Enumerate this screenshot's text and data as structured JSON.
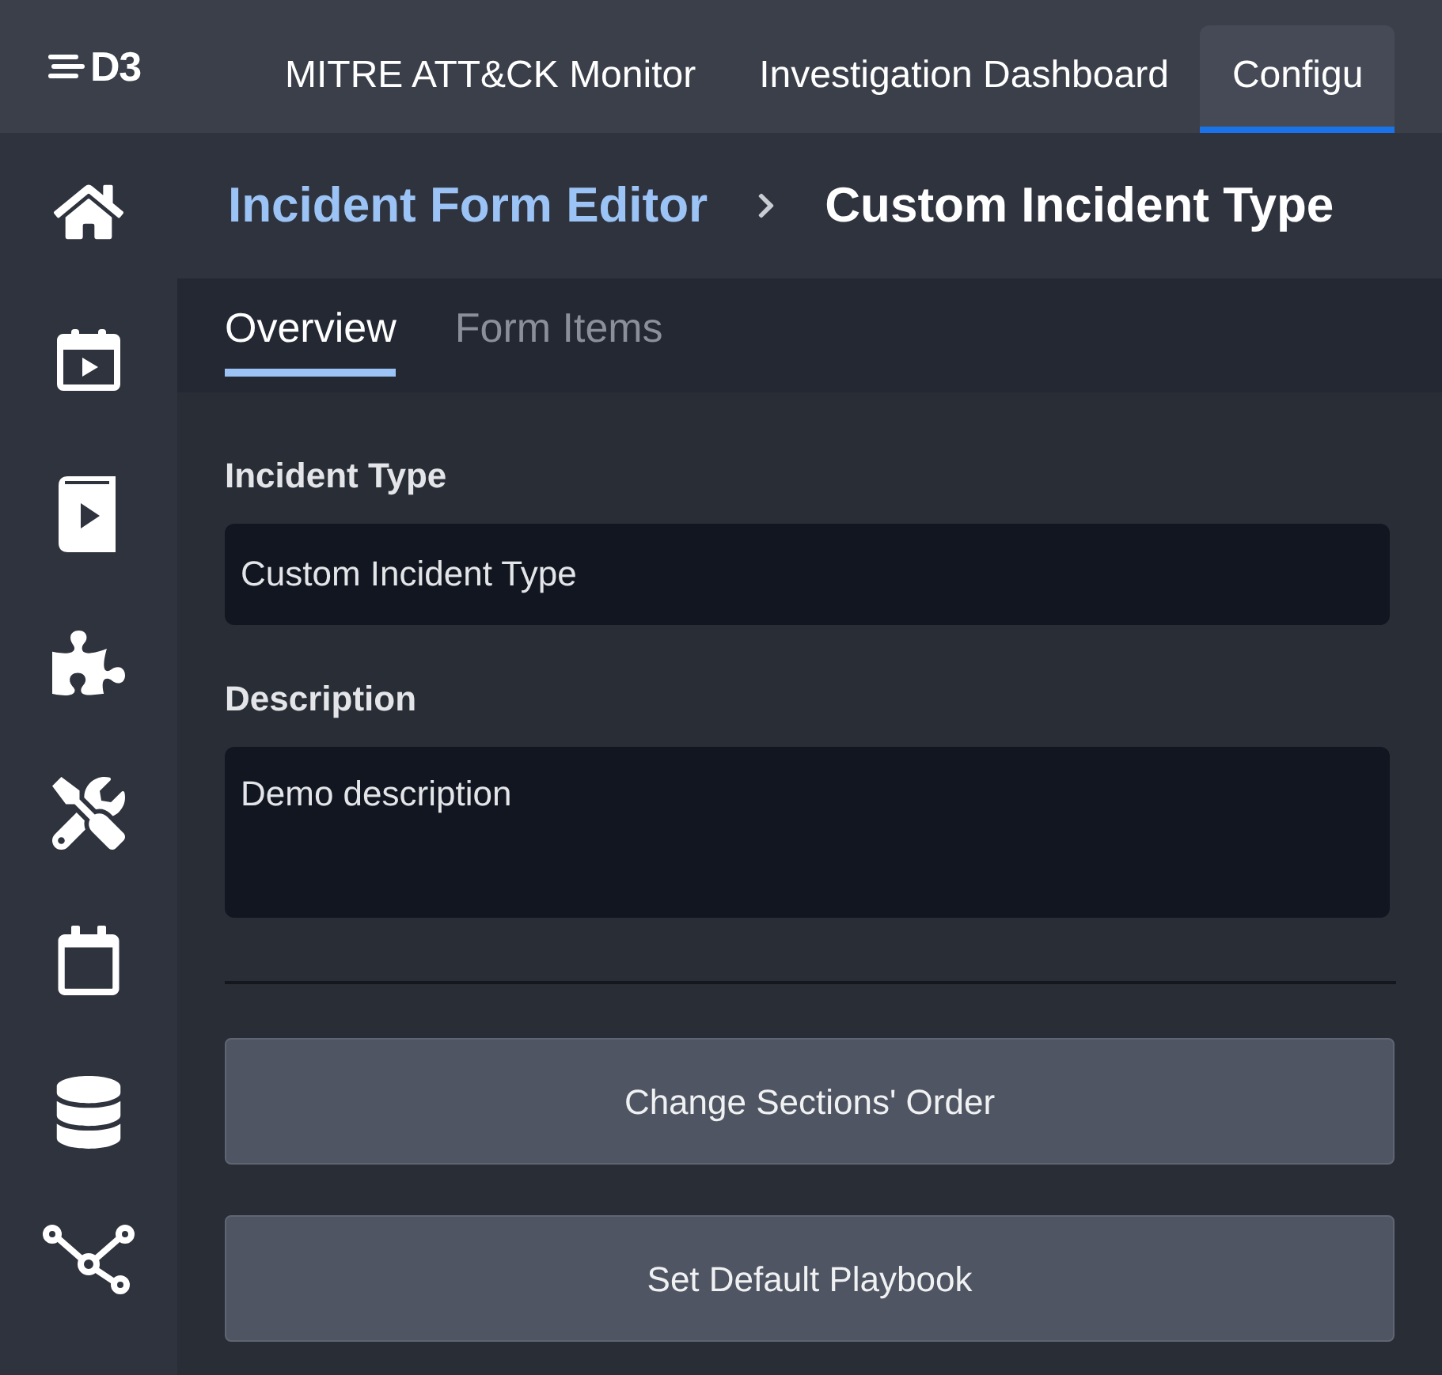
{
  "top_nav": {
    "logo": "D3",
    "items": [
      {
        "label": "MITRE ATT&CK Monitor",
        "selected": false
      },
      {
        "label": "Investigation Dashboard",
        "selected": false
      },
      {
        "label": "Configu",
        "selected": true
      }
    ]
  },
  "breadcrumb": {
    "link": "Incident Form Editor",
    "current": "Custom Incident Type"
  },
  "tabs": [
    {
      "label": "Overview",
      "selected": true
    },
    {
      "label": "Form Items",
      "selected": false
    }
  ],
  "fields": [
    {
      "label": "Incident Type",
      "value": "Custom Incident Type",
      "kind": "input"
    },
    {
      "label": "Description",
      "value": "Demo description",
      "kind": "textarea"
    }
  ],
  "buttons": [
    "Change Sections' Order",
    "Set Default Playbook"
  ]
}
